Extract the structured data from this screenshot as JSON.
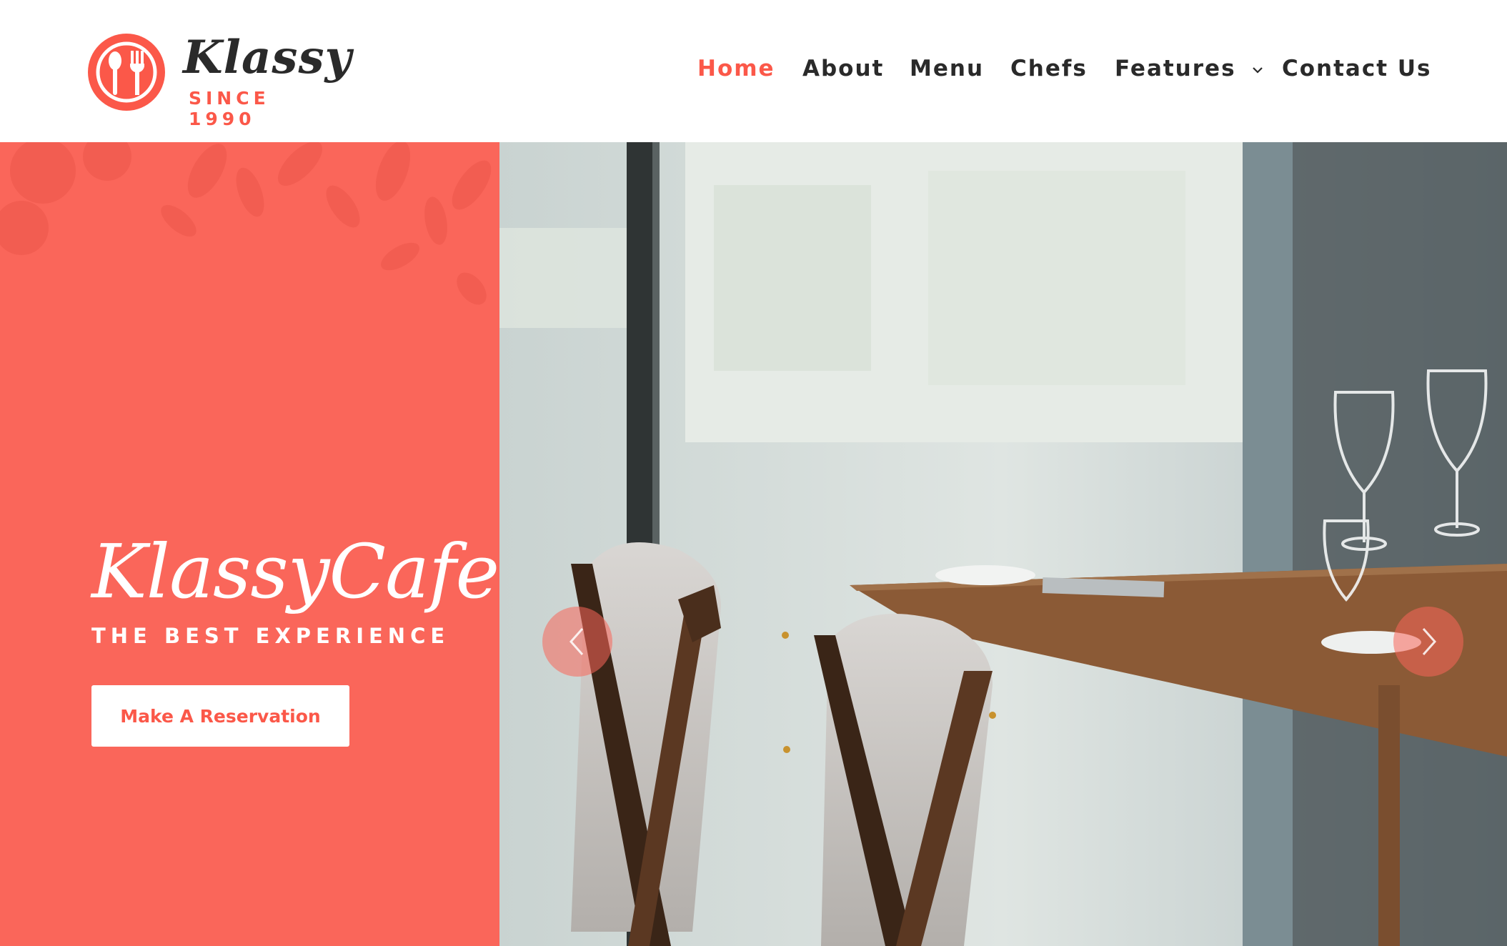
{
  "brand": {
    "name": "Klassy",
    "since": "SINCE 1990",
    "accent_color": "#fb5849",
    "panel_color": "#fa665a"
  },
  "nav": {
    "items": [
      {
        "label": "Home",
        "active": true
      },
      {
        "label": "About"
      },
      {
        "label": "Menu"
      },
      {
        "label": "Chefs"
      },
      {
        "label": "Features",
        "has_dropdown": true
      },
      {
        "label": "Contact Us"
      }
    ]
  },
  "hero": {
    "title": "KlassyCafe",
    "tagline": "THE BEST EXPERIENCE",
    "cta_label": "Make A Reservation",
    "prev_icon": "chevron-left-icon",
    "next_icon": "chevron-right-icon"
  }
}
